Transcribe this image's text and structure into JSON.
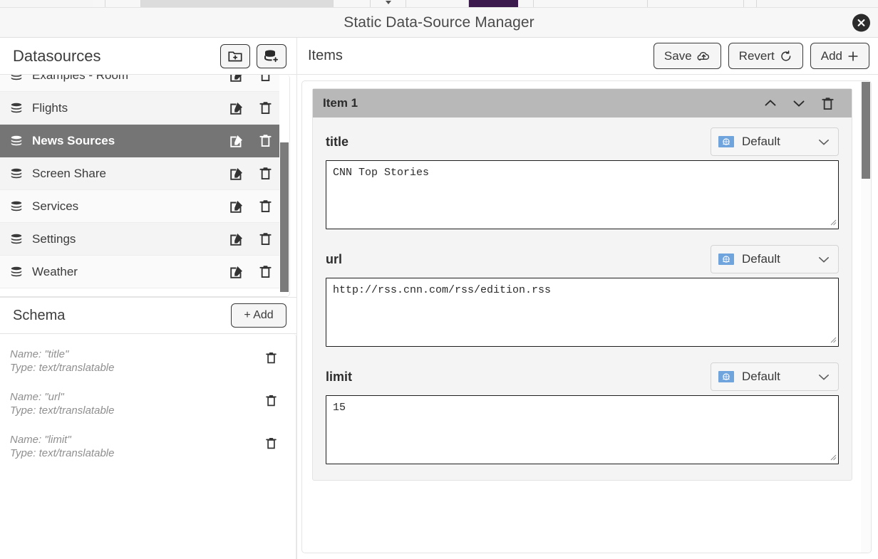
{
  "window": {
    "title": "Static Data-Source Manager",
    "close_icon": "close-circle-icon"
  },
  "chrome_strip": {
    "accent_color": "#3d1a4e"
  },
  "datasources_panel": {
    "header_title": "Datasources",
    "add_folder_button": {
      "icon": "folder-add-icon",
      "label": ""
    },
    "add_datasource_button": {
      "icon": "database-add-icon",
      "label": ""
    },
    "items": [
      {
        "label": "Examples - Room",
        "icon": "database-icon",
        "selected": false,
        "partial": true
      },
      {
        "label": "Flights",
        "icon": "database-icon",
        "selected": false
      },
      {
        "label": "News Sources",
        "icon": "database-icon",
        "selected": true
      },
      {
        "label": "Screen Share",
        "icon": "database-icon",
        "selected": false
      },
      {
        "label": "Services",
        "icon": "database-icon",
        "selected": false
      },
      {
        "label": "Settings",
        "icon": "database-icon",
        "selected": false
      },
      {
        "label": "Weather",
        "icon": "database-icon",
        "selected": false
      }
    ],
    "row_actions": {
      "edit_icon": "edit-square-icon",
      "delete_icon": "trash-icon"
    },
    "selected_row_color": "#757575"
  },
  "schema_panel": {
    "header_title": "Schema",
    "add_label": "+ Add",
    "fields": [
      {
        "name_line": "Name: \"title\"",
        "type_line": "Type: text/translatable"
      },
      {
        "name_line": "Name: \"url\"",
        "type_line": "Type: text/translatable"
      },
      {
        "name_line": "Name: \"limit\"",
        "type_line": "Type: text/translatable"
      }
    ],
    "delete_icon": "trash-icon"
  },
  "items_panel": {
    "header_title": "Items",
    "save_label": "Save",
    "save_icon": "cloud-upload-icon",
    "revert_label": "Revert",
    "revert_icon": "refresh-icon",
    "add_label": "Add",
    "add_icon": "plus-icon",
    "cards": [
      {
        "title": "Item 1",
        "header_color": "#b8b8b8",
        "move_up_icon": "chevron-up-icon",
        "move_down_icon": "chevron-down-icon",
        "delete_icon": "trash-icon",
        "fields": [
          {
            "name": "title",
            "language": "Default",
            "language_flag": "un-flag-icon",
            "value": "CNN Top Stories",
            "placeholder": ""
          },
          {
            "name": "url",
            "language": "Default",
            "language_flag": "un-flag-icon",
            "value": "http://rss.cnn.com/rss/edition.rss",
            "placeholder": ""
          },
          {
            "name": "limit",
            "language": "Default",
            "language_flag": "un-flag-icon",
            "value": "15",
            "placeholder": ""
          }
        ]
      }
    ]
  }
}
